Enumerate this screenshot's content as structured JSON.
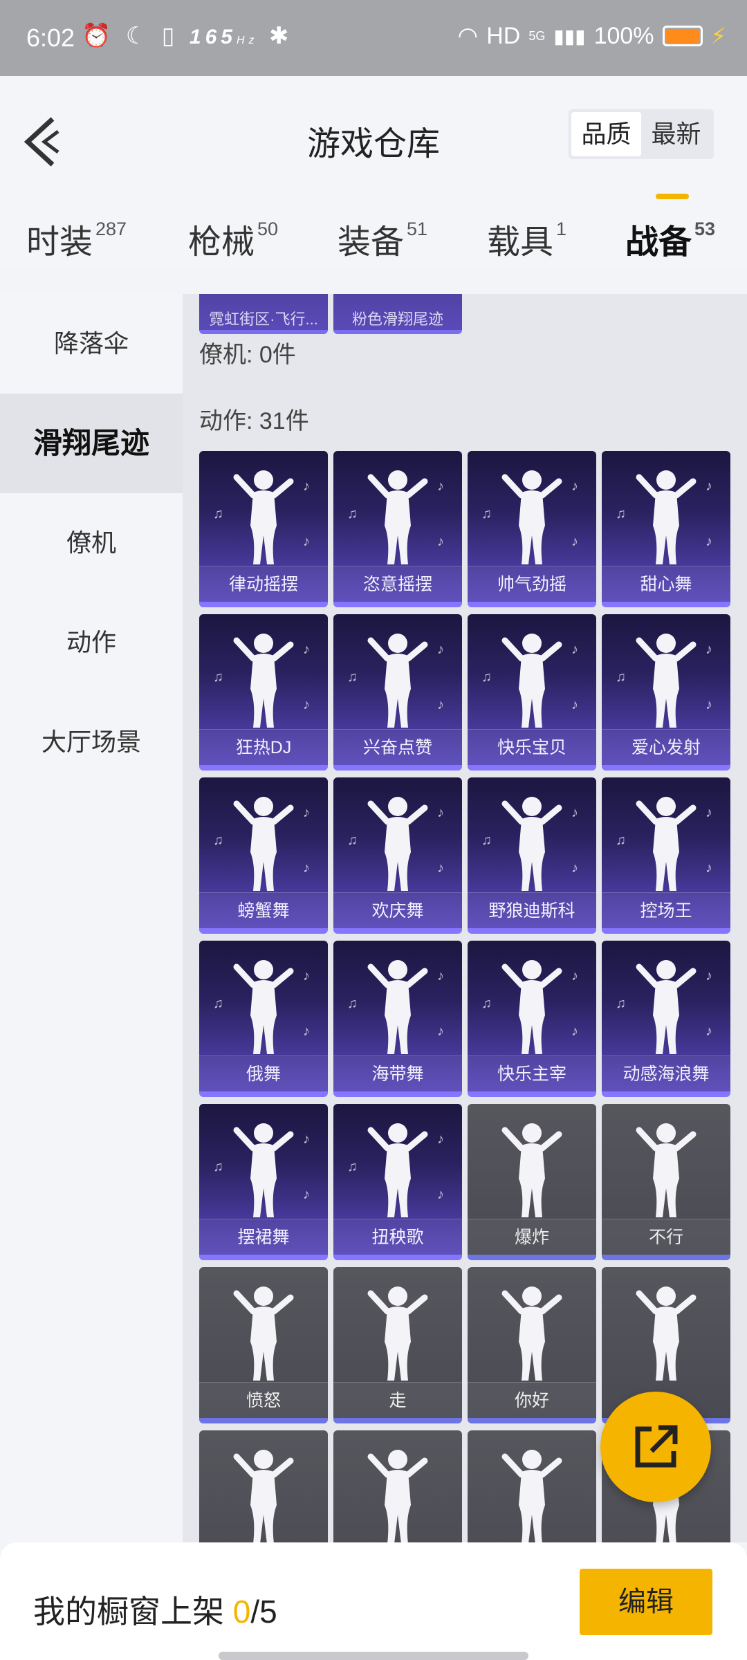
{
  "status_bar": {
    "time": "6:02",
    "refresh_rate": "165",
    "refresh_unit": "Hz",
    "network": "HD",
    "signal": "5G",
    "battery": "100%"
  },
  "header": {
    "title": "游戏仓库",
    "sort_options": [
      "品质",
      "最新"
    ],
    "sort_selected": "品质"
  },
  "tabs": [
    {
      "label": "时装",
      "count": "287"
    },
    {
      "label": "枪械",
      "count": "50"
    },
    {
      "label": "装备",
      "count": "51"
    },
    {
      "label": "载具",
      "count": "1"
    },
    {
      "label": "战备",
      "count": "53"
    }
  ],
  "active_tab": "战备",
  "sidebar": {
    "items": [
      {
        "label": "降落伞"
      },
      {
        "label": "滑翔尾迹"
      },
      {
        "label": "僚机"
      },
      {
        "label": "动作"
      },
      {
        "label": "大厅场景"
      }
    ],
    "active": "滑翔尾迹"
  },
  "content": {
    "partial_cards": [
      "霓虹街区·飞行...",
      "粉色滑翔尾迹"
    ],
    "wingman_section": "僚机: 0件",
    "emote_section": "动作: 31件",
    "emotes": [
      {
        "name": "律动摇摆",
        "style": "purple"
      },
      {
        "name": "恣意摇摆",
        "style": "purple"
      },
      {
        "name": "帅气劲摇",
        "style": "purple"
      },
      {
        "name": "甜心舞",
        "style": "purple"
      },
      {
        "name": "狂热DJ",
        "style": "purple"
      },
      {
        "name": "兴奋点赞",
        "style": "purple"
      },
      {
        "name": "快乐宝贝",
        "style": "purple"
      },
      {
        "name": "爱心发射",
        "style": "purple"
      },
      {
        "name": "螃蟹舞",
        "style": "purple"
      },
      {
        "name": "欢庆舞",
        "style": "purple"
      },
      {
        "name": "野狼迪斯科",
        "style": "purple"
      },
      {
        "name": "控场王",
        "style": "purple"
      },
      {
        "name": "俄舞",
        "style": "purple"
      },
      {
        "name": "海带舞",
        "style": "purple"
      },
      {
        "name": "快乐主宰",
        "style": "purple"
      },
      {
        "name": "动感海浪舞",
        "style": "purple"
      },
      {
        "name": "摆裙舞",
        "style": "purple"
      },
      {
        "name": "扭秧歌",
        "style": "purple"
      },
      {
        "name": "爆炸",
        "style": "grey"
      },
      {
        "name": "不行",
        "style": "grey"
      },
      {
        "name": "愤怒",
        "style": "grey"
      },
      {
        "name": "走",
        "style": "grey"
      },
      {
        "name": "你好",
        "style": "grey"
      },
      {
        "name": "",
        "style": "grey"
      },
      {
        "name": "",
        "style": "grey"
      },
      {
        "name": "",
        "style": "grey"
      },
      {
        "name": "",
        "style": "grey"
      },
      {
        "name": "",
        "style": "grey"
      }
    ]
  },
  "bottom_bar": {
    "label": "我的橱窗上架",
    "current": "0",
    "separator": "/",
    "max": "5",
    "edit_button": "编辑"
  },
  "colors": {
    "accent": "#f5b400",
    "card_purple": "#4a3ba0",
    "card_grey": "#4f4f56"
  }
}
